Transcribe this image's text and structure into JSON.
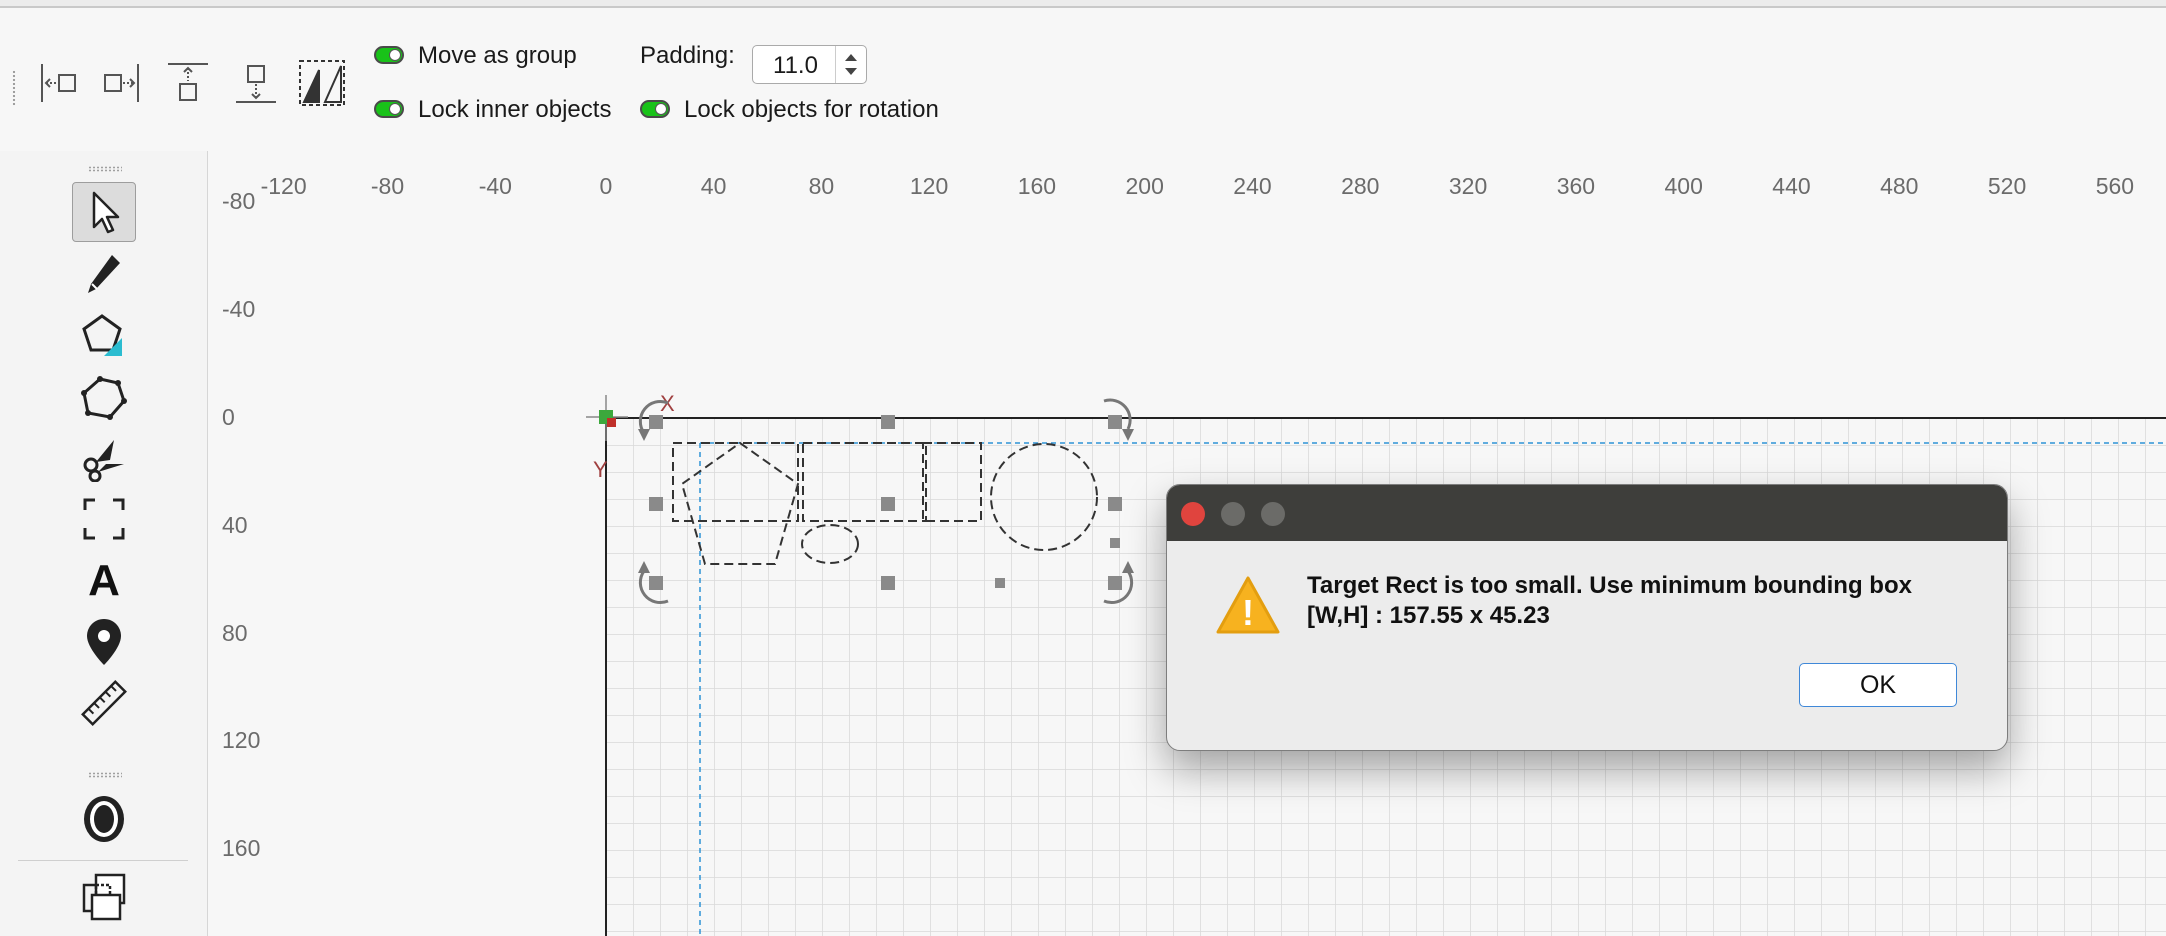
{
  "toolbar": {
    "align_buttons": [
      "align-left-icon",
      "align-right-icon",
      "align-top-icon",
      "align-bottom-icon",
      "align-diagonal-icon"
    ],
    "move_as_group_label": "Move as group",
    "lock_inner_objects_label": "Lock inner objects",
    "lock_rotation_label": "Lock objects for rotation",
    "padding_label": "Padding:",
    "padding_value": "11.0",
    "toggle_color": "#19c219"
  },
  "tools": [
    "select-pointer-icon",
    "pencil-icon",
    "polygon-icon",
    "polyline-icon",
    "scissors-icon",
    "crop-rect-icon",
    "text-tool-icon",
    "map-pin-icon",
    "ruler-icon",
    "ring-icon",
    "boolean-shapes-icon"
  ],
  "text_tool_glyph": "A",
  "ruler": {
    "x_labels": [
      "-120",
      "-80",
      "-40",
      "0",
      "40",
      "80",
      "120",
      "160",
      "200",
      "240",
      "280",
      "320",
      "360",
      "400",
      "440",
      "480",
      "520",
      "560"
    ],
    "y_labels": [
      "-80",
      "-40",
      "0",
      "40",
      "80",
      "120",
      "160"
    ]
  },
  "axis": {
    "x_letter": "X",
    "y_letter": "Y"
  },
  "dialog": {
    "message_line1": "Target Rect is too small. Use minimum bounding box",
    "message_line2": "[W,H] : 157.55 x 45.23",
    "ok_label": "OK",
    "warning_symbol": "!",
    "close_color": "#e0443e",
    "inactive_color": "#6b6b68"
  }
}
